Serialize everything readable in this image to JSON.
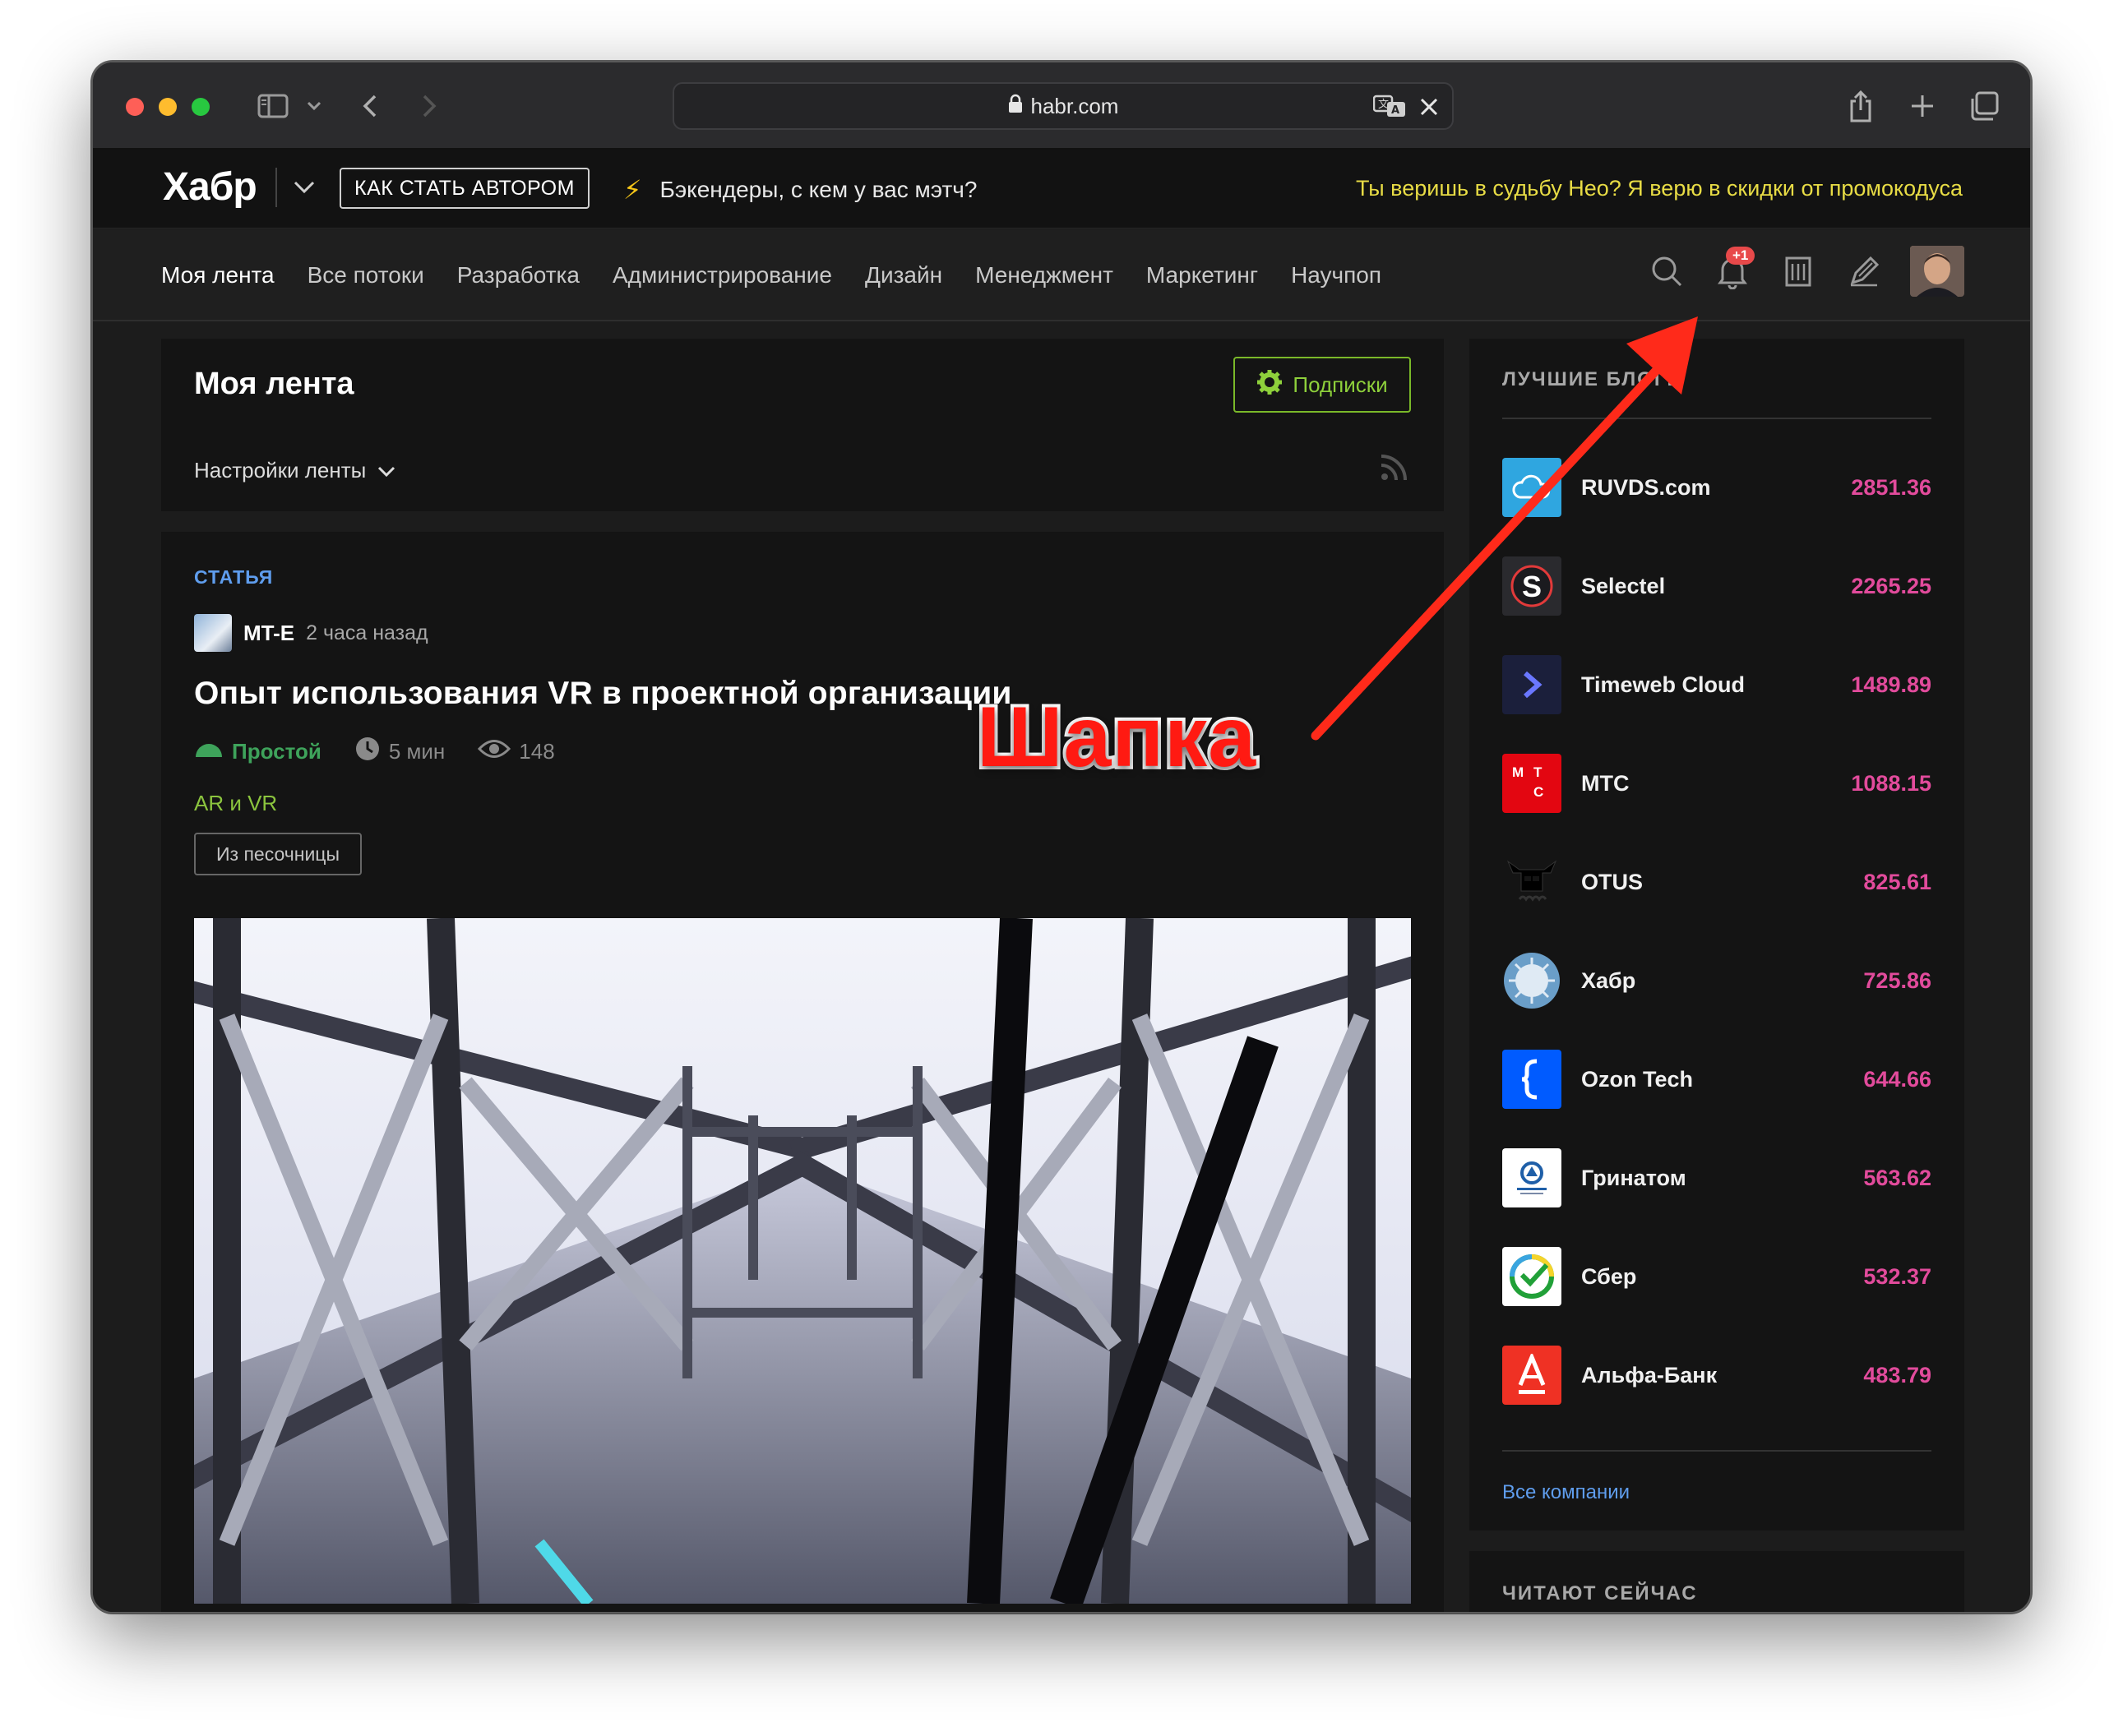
{
  "browser": {
    "url": "habr.com",
    "icons": [
      "sidebar-icon",
      "chevron-down-icon",
      "back-icon",
      "forward-icon",
      "lock-icon",
      "translate-icon",
      "close-icon",
      "share-icon",
      "new-tab-icon",
      "tabs-overview-icon"
    ]
  },
  "header": {
    "logo": "Хабр",
    "author_button": "КАК СТАТЬ АВТОРОМ",
    "promo_left": "Бэкендеры, с кем у вас мэтч?",
    "promo_right": "Ты веришь в судьбу Нео? Я верю в скидки от промокодуса"
  },
  "nav": {
    "items": [
      "Моя лента",
      "Все потоки",
      "Разработка",
      "Администрирование",
      "Дизайн",
      "Менеджмент",
      "Маркетинг",
      "Научпоп"
    ],
    "notification_badge": "+1",
    "icons": [
      "search-icon",
      "bell-icon",
      "building-icon",
      "pen-icon",
      "avatar"
    ]
  },
  "feed": {
    "title": "Моя лента",
    "subscriptions_button": "Подписки",
    "settings_label": "Настройки ленты"
  },
  "article": {
    "type": "СТАТЬЯ",
    "author": "MT-E",
    "time": "2 часа назад",
    "title": "Опыт использования VR в проектной организации",
    "level": "Простой",
    "read_time": "5 мин",
    "views": "148",
    "hub": "AR и VR",
    "tag": "Из песочницы"
  },
  "sidebar": {
    "title": "ЛУЧШИЕ БЛОГИ",
    "companies": [
      {
        "name": "RUVDS.com",
        "rating": "2851.36",
        "color": "#2fa6e0"
      },
      {
        "name": "Selectel",
        "rating": "2265.25",
        "color": "#2a2a2e"
      },
      {
        "name": "Timeweb Cloud",
        "rating": "1489.89",
        "color": "#1b1f3b"
      },
      {
        "name": "МТС",
        "rating": "1088.15",
        "color": "#e30611"
      },
      {
        "name": "OTUS",
        "rating": "825.61",
        "color": "#141414"
      },
      {
        "name": "Хабр",
        "rating": "725.86",
        "color": "#5a8fb8"
      },
      {
        "name": "Ozon Tech",
        "rating": "644.66",
        "color": "#005bff"
      },
      {
        "name": "Гринатом",
        "rating": "563.62",
        "color": "#ffffff"
      },
      {
        "name": "Сбер",
        "rating": "532.37",
        "color": "#ffffff"
      },
      {
        "name": "Альфа-Банк",
        "rating": "483.79",
        "color": "#ef3124"
      }
    ],
    "all_companies": "Все компании",
    "reading_now_title": "ЧИТАЮТ СЕЙЧАС"
  },
  "annotation": {
    "label": "Шапка",
    "color": "#ff1a12"
  }
}
